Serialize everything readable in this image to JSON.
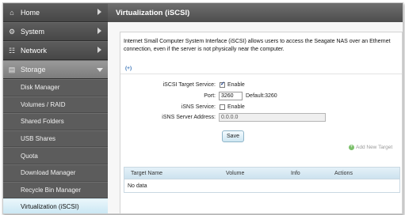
{
  "sidebar": {
    "top_items": [
      {
        "label": "Home",
        "icon": "home-icon"
      },
      {
        "label": "System",
        "icon": "system-icon"
      },
      {
        "label": "Network",
        "icon": "network-icon"
      },
      {
        "label": "Storage",
        "icon": "storage-icon"
      }
    ],
    "storage_items": [
      {
        "label": "Disk Manager"
      },
      {
        "label": "Volumes / RAID"
      },
      {
        "label": "Shared Folders"
      },
      {
        "label": "USB Shares"
      },
      {
        "label": "Quota"
      },
      {
        "label": "Download Manager"
      },
      {
        "label": "Recycle Bin Manager"
      },
      {
        "label": "Virtualization (iSCSI)"
      }
    ]
  },
  "main": {
    "title": "Virtualization (iSCSI)",
    "description": "Internet Small Computer System Interface (iSCSI) allows users to access the Seagate NAS over an Ethernet connection, even if the server is not physically near the computer.",
    "expand_label": "(+)",
    "form": {
      "target_service_label": "iSCSI Target Service:",
      "target_service_enable": "Enable",
      "target_service_checked": true,
      "port_label": "Port:",
      "port_value": "3260",
      "port_default": "Default:3260",
      "isns_service_label": "iSNS Service:",
      "isns_service_enable": "Enable",
      "isns_service_checked": false,
      "isns_address_label": "iSNS Server Address:",
      "isns_address_value": "0.0.0.0",
      "save_label": "Save"
    },
    "add_target_label": "Add New Target",
    "table": {
      "columns": [
        "Target Name",
        "Volume",
        "Info",
        "Actions"
      ],
      "empty_text": "No data"
    }
  },
  "colors": {
    "sidebar_bg": "#4a4a4a",
    "active_item_bg": "#c8e6f3",
    "titlebar_bg": "#5d5d5d",
    "link_blue": "#3a74b8"
  }
}
